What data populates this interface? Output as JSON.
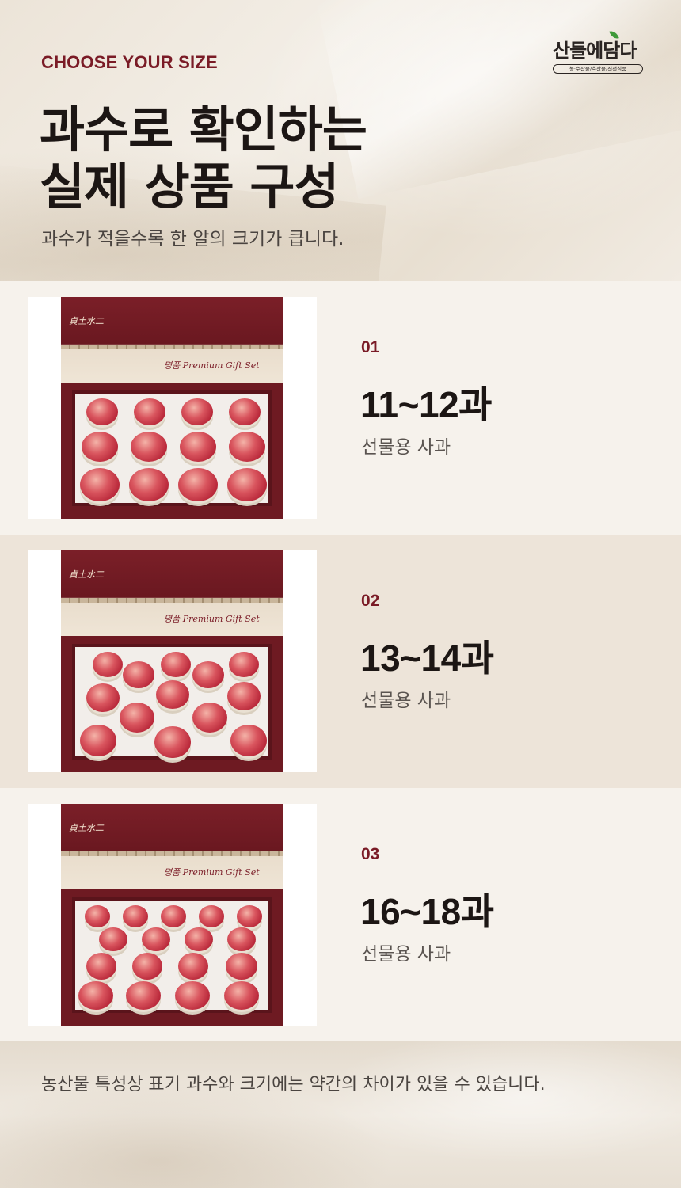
{
  "header": {
    "kicker": "CHOOSE YOUR SIZE",
    "headline_line1": "과수로 확인하는",
    "headline_line2": "실제 상품 구성",
    "subline": "과수가 적을수록 한 알의 크기가 큽니다."
  },
  "logo": {
    "name": "산들에담다",
    "tagline": "농·수산물/축산물/신선식품"
  },
  "options": [
    {
      "number": "01",
      "count": "11~12과",
      "label": "선물용 사과",
      "photo_text": {
        "brand": "貞土水二",
        "script": "명품 Premium Gift Set"
      }
    },
    {
      "number": "02",
      "count": "13~14과",
      "label": "선물용 사과",
      "photo_text": {
        "brand": "貞土水二",
        "script": "명품 Premium Gift Set"
      }
    },
    {
      "number": "03",
      "count": "16~18과",
      "label": "선물용 사과",
      "photo_text": {
        "brand": "貞土水二",
        "script": "명품 Premium Gift Set"
      }
    }
  ],
  "footer": {
    "note": "농산물 특성상 표기 과수와 크기에는 약간의 차이가 있을 수 있습니다."
  },
  "colors": {
    "accent": "#7a1b26",
    "text": "#1c1614",
    "row_light": "#f6f2ec",
    "row_dark": "#ede4d9"
  }
}
